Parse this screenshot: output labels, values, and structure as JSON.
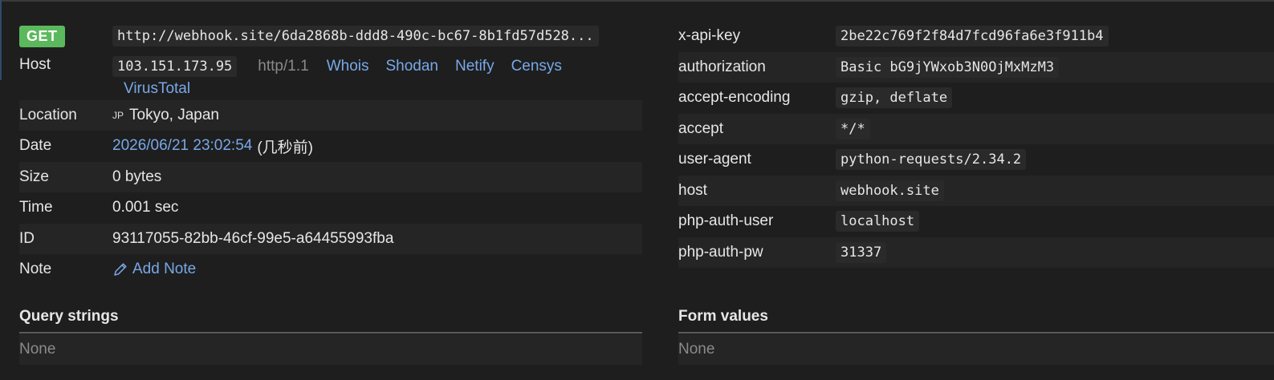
{
  "request": {
    "method": "GET",
    "url": "http://webhook.site/6da2868b-ddd8-490c-bc67-8b1fd57d528...",
    "host_label": "Host",
    "host_ip": "103.151.173.95",
    "protocol": "http/1.1",
    "host_links": [
      "Whois",
      "Shodan",
      "Netify",
      "Censys",
      "VirusTotal"
    ],
    "location_label": "Location",
    "location_flag": "JP",
    "location": "Tokyo, Japan",
    "date_label": "Date",
    "date": "2026/06/21 23:02:54",
    "date_relative": "(几秒前)",
    "size_label": "Size",
    "size": "0 bytes",
    "time_label": "Time",
    "time": "0.001 sec",
    "id_label": "ID",
    "id": "93117055-82bb-46cf-99e5-a64455993fba",
    "note_label": "Note",
    "add_note": "Add Note"
  },
  "headers": [
    {
      "key": "x-api-key",
      "value": "2be22c769f2f84d7fcd96fa6e3f911b4"
    },
    {
      "key": "authorization",
      "value": "Basic bG9jYWxob3N0OjMxMzM3"
    },
    {
      "key": "accept-encoding",
      "value": "gzip, deflate"
    },
    {
      "key": "accept",
      "value": "*/*"
    },
    {
      "key": "user-agent",
      "value": "python-requests/2.34.2"
    },
    {
      "key": "host",
      "value": "webhook.site"
    },
    {
      "key": "php-auth-user",
      "value": "localhost"
    },
    {
      "key": "php-auth-pw",
      "value": "31337"
    }
  ],
  "query_strings": {
    "title": "Query strings",
    "value": "None"
  },
  "form_values": {
    "title": "Form values",
    "value": "None"
  },
  "colors": {
    "badge_get": "#5cb85c",
    "link": "#78a8e8",
    "background": "#1e1e1e"
  },
  "icons": {
    "note": "pencil-icon"
  }
}
